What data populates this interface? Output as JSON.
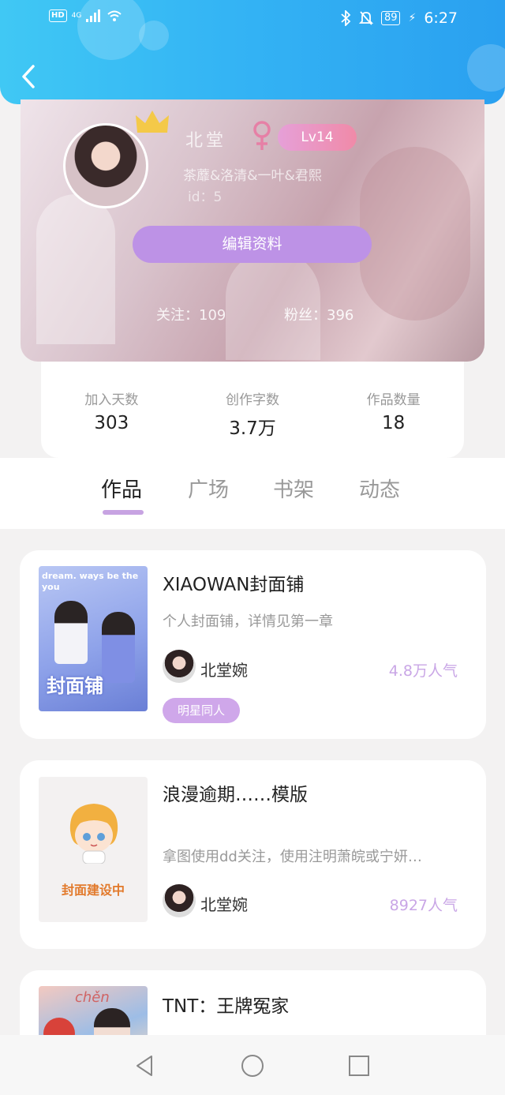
{
  "status_bar": {
    "hd": "HD",
    "network": "4G",
    "battery": "89",
    "time": "6:27"
  },
  "profile": {
    "username": "北堂",
    "level": "Lv14",
    "bio": "茶蘼&洛清&一叶&君熙",
    "uid": "id：5",
    "edit_button": "编辑资料",
    "following": "关注：109",
    "fans": "粉丝：396"
  },
  "stats": [
    {
      "label": "加入天数",
      "value": "303"
    },
    {
      "label": "创作字数",
      "value": "3.7万"
    },
    {
      "label": "作品数量",
      "value": "18"
    }
  ],
  "tabs": [
    "作品",
    "广场",
    "书架",
    "动态"
  ],
  "works": [
    {
      "title": "XIAOWAN封面铺",
      "desc": "个人封面铺，详情见第一章",
      "author": "北堂婉",
      "popularity": "4.8万人气",
      "tag": "明星同人",
      "cover_text": "封面铺",
      "cover_caption": "dream. ways be the you"
    },
    {
      "title": "浪漫逾期……模版",
      "desc": "拿图使用dd关注，使用注明萧皖或宁妍…",
      "author": "北堂婉",
      "popularity": "8927人气",
      "cover_text": "封面建设中"
    },
    {
      "title": "TNT：王牌冤家",
      "desc": "",
      "cover_text": "chěn"
    }
  ]
}
